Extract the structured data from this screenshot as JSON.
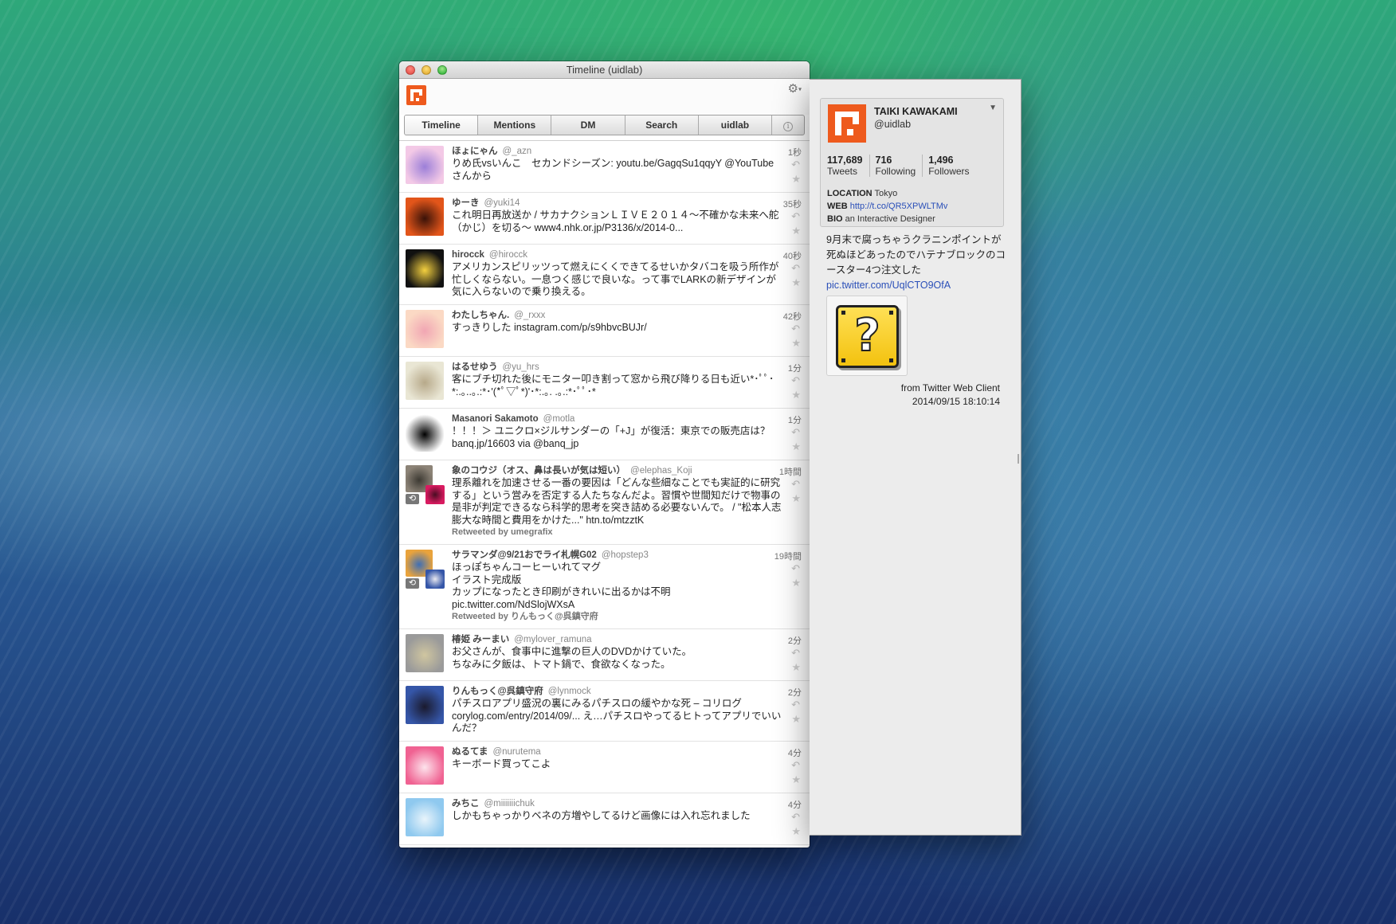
{
  "window": {
    "title": "Timeline (uidlab)"
  },
  "tabs": [
    {
      "label": "Timeline",
      "active": true
    },
    {
      "label": "Mentions",
      "active": false
    },
    {
      "label": "DM",
      "active": false
    },
    {
      "label": "Search",
      "active": false
    },
    {
      "label": "uidlab",
      "active": false
    }
  ],
  "icons": {
    "reply": "↶",
    "favorite": "★",
    "gear": "⚙",
    "info": "i",
    "retweet": "⟲",
    "dropdown": "▼"
  },
  "tweets": [
    {
      "name": "ほょにゃん",
      "handle": "@_azn",
      "text": "りめ氏vsいんこ　セカンドシーズン: youtu.be/GagqSu1qqyY @YouTubeさんから",
      "time": "1秒",
      "avatar_colors": [
        "#f3c9e6",
        "#9c7fd8"
      ]
    },
    {
      "name": "ゆーき",
      "handle": "@yuki14",
      "text": "これ明日再放送か / サカナクションＬＩＶＥ２０１４〜不確かな未来へ舵（かじ）を切る〜 www4.nhk.or.jp/P3136/x/2014-0...",
      "time": "35秒",
      "avatar_colors": [
        "#e2551a",
        "#3a1208"
      ]
    },
    {
      "name": "hirocck",
      "handle": "@hirocck",
      "text": "アメリカンスピリッツって燃えにくくできてるせいかタバコを吸う所作が忙しくならない。一息つく感じで良いな。って事でLARKの新デザインが気に入らないので乗り換える。",
      "time": "40秒",
      "avatar_colors": [
        "#111111",
        "#f4d03f"
      ]
    },
    {
      "name": "わたしちゃん.",
      "handle": "@_rxxx",
      "text": "すっきりした instagram.com/p/s9hbvcBUJr/",
      "time": "42秒",
      "avatar_colors": [
        "#fbd9c4",
        "#f1a6b3"
      ]
    },
    {
      "name": "はるせゆう",
      "handle": "@yu_hrs",
      "text": "客にブチ切れた後にモニター叩き割って窓から飛び降りる日も近い*･ﾟﾟ･*:.｡..｡.:*･'(*ﾟ▽ﾟ*)'･*:.｡. .｡.:*･ﾟﾟ･*",
      "time": "1分",
      "avatar_colors": [
        "#e9e6d4",
        "#b7a98a"
      ]
    },
    {
      "name": "Masanori Sakamoto",
      "handle": "@motla",
      "text": "！！！＞ ユニクロ×ジルサンダーの「+J」が復活：東京での販売店は？ banq.jp/16603 via @banq_jp",
      "time": "1分",
      "avatar_colors": [
        "#ffffff",
        "#000000"
      ]
    },
    {
      "name": "象のコウジ（オス、鼻は長いが気は短い）",
      "handle": "@elephas_Koji",
      "text": "理系離れを加速させる一番の要因は「どんな些細なことでも実証的に研究する」という営みを否定する人たちなんだよ。習慣や世間知だけで物事の是非が判定できるなら科学的思考を突き詰める必要ないんで。 / \"松本人志 膨大な時間と費用をかけた...\" htn.to/mtzztK",
      "time": "1時間",
      "retweeted_by": "Retweeted by umegrafix",
      "avatar_colors": [
        "#8c8377",
        "#3d3a33"
      ],
      "rt_avatar_colors": [
        "#d81b60",
        "#4a0d23"
      ]
    },
    {
      "name": "サラマンダ@9/21おでライ札幌G02",
      "handle": "@hopstep3",
      "text": "ほっぽちゃんコーヒーいれてマグ\nイラスト完成版\nカップになったとき印刷がきれいに出るかは不明 pic.twitter.com/NdSlojWXsA",
      "time": "19時間",
      "retweeted_by": "Retweeted by りんもっく@呉鎮守府",
      "avatar_colors": [
        "#e9a33c",
        "#3f6fb5"
      ],
      "rt_avatar_colors": [
        "#3556a8",
        "#e8e8f0"
      ]
    },
    {
      "name": "椿姫 みーまい",
      "handle": "@mylover_ramuna",
      "text": "お父さんが、食事中に進撃の巨人のDVDかけていた。\nちなみに夕飯は、トマト鍋で、食欲なくなった。",
      "time": "2分",
      "avatar_colors": [
        "#9a9a9a",
        "#d0c6a0"
      ]
    },
    {
      "name": "りんもっく@呉鎮守府",
      "handle": "@lynmock",
      "text": "パチスロアプリ盛況の裏にみるパチスロの緩やかな死 – コリログ corylog.com/entry/2014/09/... え…パチスロやってるヒトってアプリでいいんだ？",
      "time": "2分",
      "avatar_colors": [
        "#3556a8",
        "#1a1a2e"
      ]
    },
    {
      "name": "ぬるてま",
      "handle": "@nurutema",
      "text": "キーボード買ってこよ",
      "time": "4分",
      "avatar_colors": [
        "#f06292",
        "#fde3ec"
      ]
    },
    {
      "name": "みちこ",
      "handle": "@miiiiiiichuk",
      "text": "しかもちゃっかりベネの方増やしてるけど画像には入れ忘れました",
      "time": "4分",
      "avatar_colors": [
        "#8fc9ef",
        "#e8f4fb"
      ]
    }
  ],
  "profile": {
    "name": "TAIKI KAWAKAMI",
    "handle": "@uidlab",
    "stats": [
      {
        "value": "117,689",
        "label": "Tweets"
      },
      {
        "value": "716",
        "label": "Following"
      },
      {
        "value": "1,496",
        "label": "Followers"
      }
    ],
    "location_label": "LOCATION",
    "location": "Tokyo",
    "web_label": "WEB",
    "web": "http://t.co/QR5XPWLTMv",
    "bio_label": "BIO",
    "bio": "an Interactive Designer"
  },
  "detail": {
    "text": "9月末で腐っちゃうクラニンポイントが死ぬほどあったのでハテナブロックのコースター4つ注文した",
    "link": "pic.twitter.com/UqlCTO9OfA",
    "thumb_glyph": "?",
    "source": "from Twitter Web Client",
    "timestamp": "2014/09/15 18:10:14"
  },
  "colors": {
    "accent": "#ee5a1d",
    "link": "#2a4fb8"
  }
}
